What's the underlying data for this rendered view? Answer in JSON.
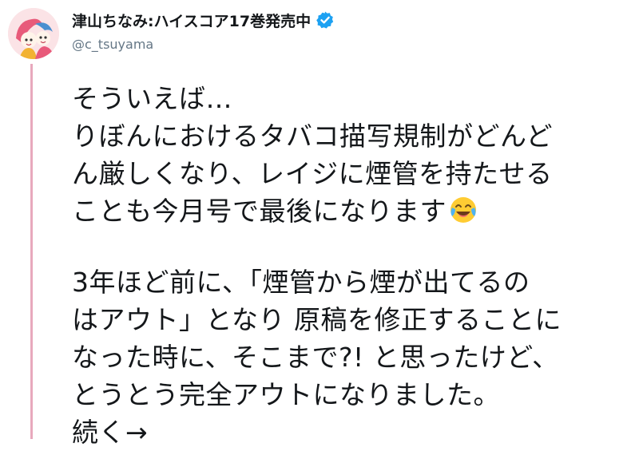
{
  "profile": {
    "display_name": "津山ちなみ:ハイスコア17巻発売中",
    "handle": "@c_tsuyama",
    "verified": true,
    "avatar_icon": "avatar-illustration-icon",
    "verified_icon": "verified-badge-icon"
  },
  "tweet": {
    "lines": [
      "そういえば…",
      "りぼんにおけるタバコ描写規制がどんど",
      "ん厳しくなり、レイジに煙管を持たせる",
      "ことも今月号で最後になります"
    ],
    "emoji": "face-with-tears-of-joy",
    "lines2": [
      "3年ほど前に、「煙管から煙が出てるの",
      "はアウト」となり 原稿を修正することに",
      "なった時に、そこまで?! と思ったけど、",
      "とうとう完全アウトになりました。",
      "続く→"
    ]
  },
  "colors": {
    "verified_blue": "#1da1f2",
    "thread_line": "#e8a9bd",
    "handle_gray": "#657786",
    "text": "#14171a"
  }
}
